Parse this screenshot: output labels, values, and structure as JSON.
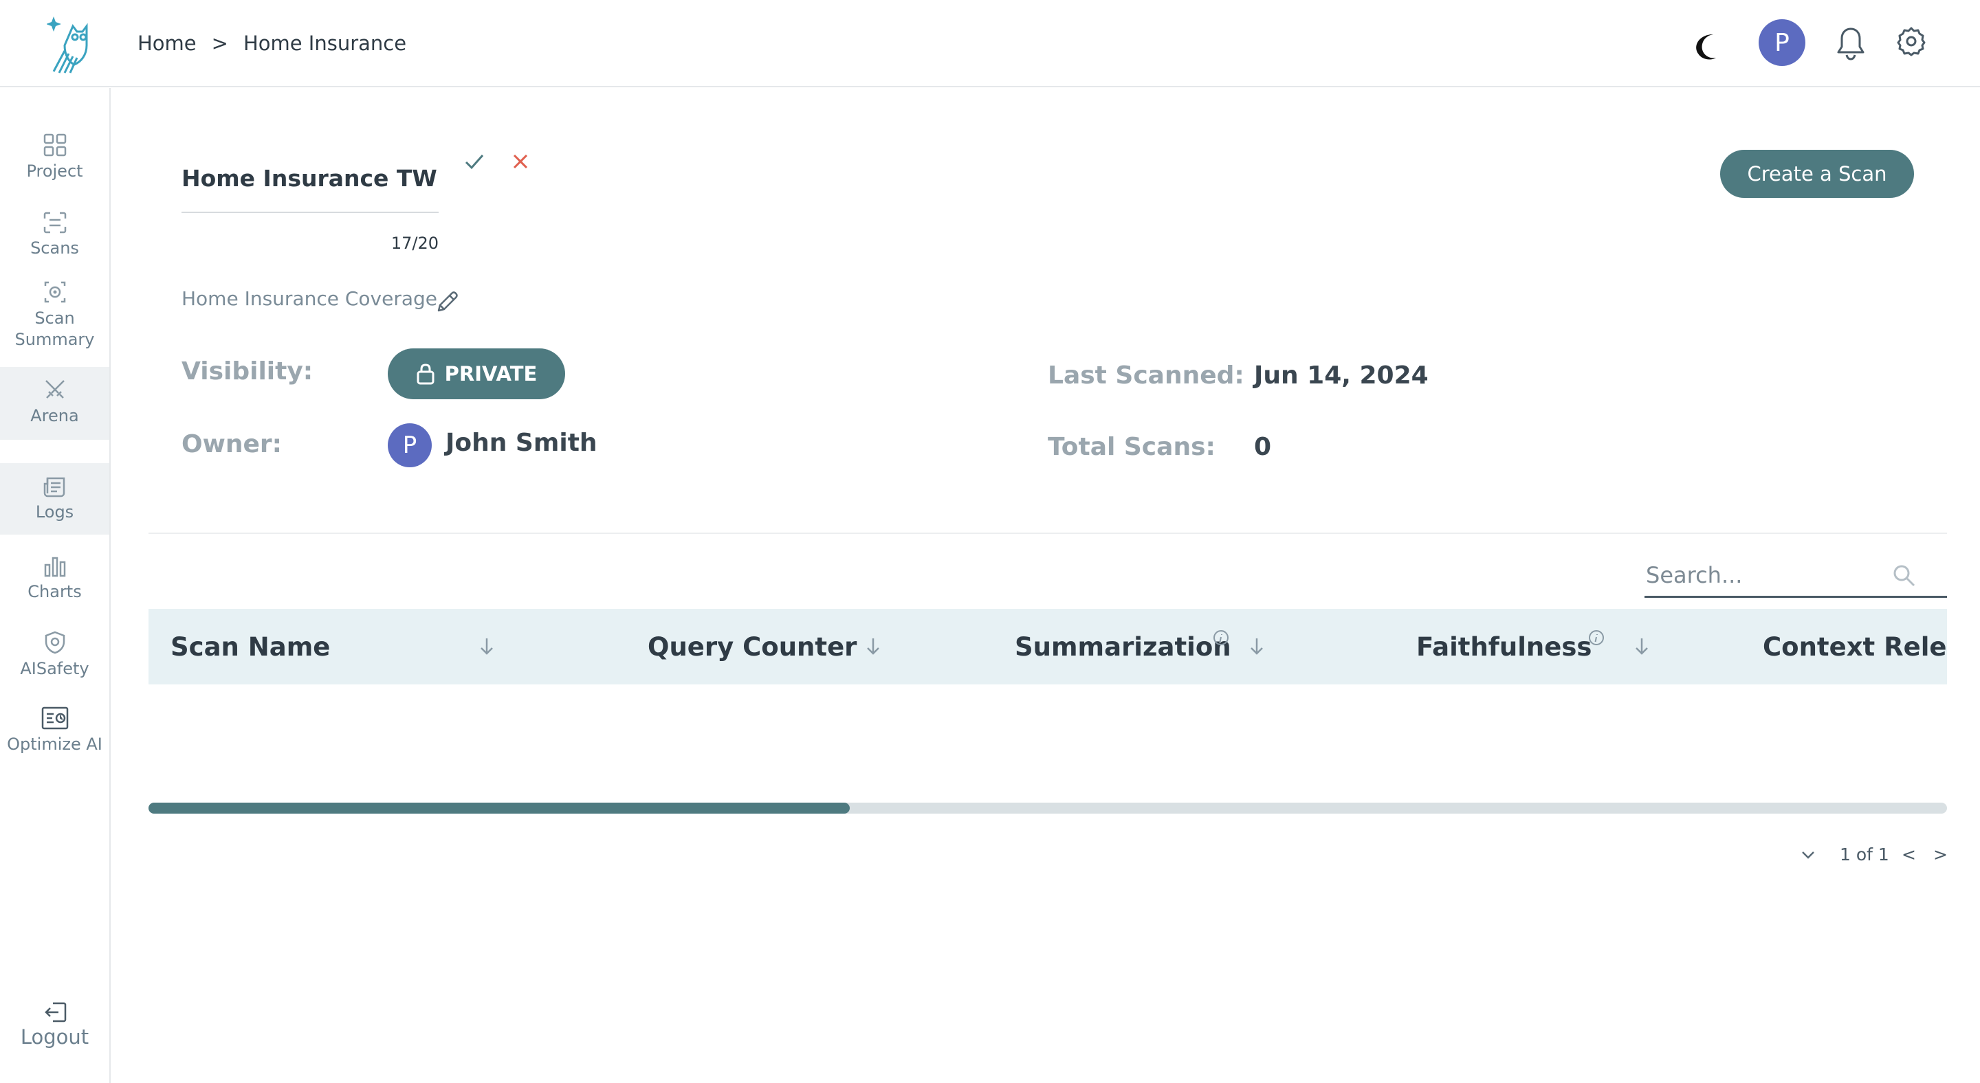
{
  "header": {
    "breadcrumb": [
      "Home",
      "Home Insurance"
    ],
    "breadcrumb_separator": ">",
    "avatar_initial": "P",
    "icons": [
      "app-logo-owl-icon",
      "moon-icon",
      "bell-icon",
      "gear-icon"
    ]
  },
  "sidebar": {
    "items": [
      {
        "label": "Project",
        "icon": "grid-icon"
      },
      {
        "label": "Scans",
        "icon": "scan-icon"
      },
      {
        "label": "Scan Summary",
        "icon": "scan-summary-icon"
      },
      {
        "label": "Arena",
        "icon": "swords-icon",
        "active": true
      },
      {
        "label": "Logs",
        "icon": "logs-icon",
        "active": true
      },
      {
        "label": "Charts",
        "icon": "bar-chart-icon"
      },
      {
        "label": "AISafety",
        "icon": "shield-icon"
      },
      {
        "label": "Optimize AI",
        "icon": "optimize-icon"
      }
    ],
    "logout_label": "Logout"
  },
  "project": {
    "name": "Home Insurance TW",
    "char_count": "17/20",
    "description": "Home Insurance Coverage",
    "visibility_label": "Visibility:",
    "visibility_value": "PRIVATE",
    "owner_label": "Owner:",
    "owner_initial": "P",
    "owner_name": "John Smith",
    "last_scanned_label": "Last Scanned:",
    "last_scanned_value": "Jun 14, 2024",
    "total_scans_label": "Total Scans:",
    "total_scans_value": "0"
  },
  "actions": {
    "create_scan_label": "Create a Scan"
  },
  "search": {
    "placeholder": "Search..."
  },
  "table": {
    "columns": [
      "Scan Name",
      "Query Counter",
      "Summarization",
      "Faithfulness",
      "Context Releva"
    ],
    "scroll_position_fraction": 0.39
  },
  "pagination": {
    "page_text": "1 of 1",
    "prev_label": "<",
    "next_label": ">"
  },
  "colors": {
    "accent": "#4e7a80",
    "avatar": "#5c6bc0",
    "table_header_bg": "#e7f1f4",
    "cancel_red": "#e0604f",
    "logo_teal": "#3aa3c0"
  }
}
